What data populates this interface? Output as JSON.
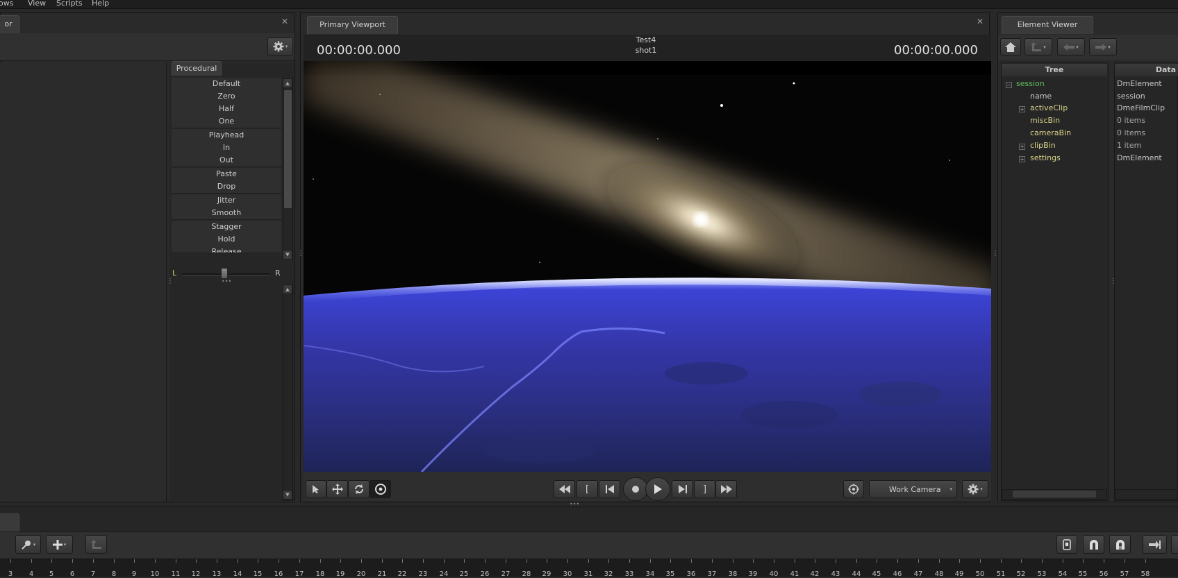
{
  "menu": [
    "ows",
    "View",
    "Scripts",
    "Help"
  ],
  "left_panel": {
    "tab_label": "or",
    "procedural_tab": "Procedural",
    "procedural_items": [
      "Default",
      "Zero",
      "Half",
      "One",
      "Playhead",
      "In",
      "Out",
      "Paste",
      "Drop",
      "Jitter",
      "Smooth",
      "Stagger",
      "Hold",
      "Release"
    ],
    "balance_left": "L",
    "balance_right": "R"
  },
  "viewport": {
    "tab_label": "Primary Viewport",
    "timecode_left": "00:00:00.000",
    "timecode_right": "00:00:00.000",
    "clip_name": "Test4",
    "shot_name": "shot1",
    "camera_label": "Work Camera"
  },
  "element_viewer": {
    "tab_label": "Element Viewer",
    "tree_header": "Tree",
    "data_header": "Data",
    "rows": [
      {
        "label": "session",
        "data": "DmElement"
      },
      {
        "label": "name",
        "data": "session"
      },
      {
        "label": "activeClip",
        "data": "DmeFilmClip"
      },
      {
        "label": "miscBin",
        "data": "0 items"
      },
      {
        "label": "cameraBin",
        "data": "0 items"
      },
      {
        "label": "clipBin",
        "data": "1 item"
      },
      {
        "label": "settings",
        "data": "DmElement"
      }
    ]
  },
  "ruler_labels": [
    "3",
    "4",
    "5",
    "6",
    "7",
    "8",
    "9",
    "10",
    "11",
    "12",
    "13",
    "14",
    "15",
    "16",
    "17",
    "18",
    "19",
    "20",
    "21",
    "22",
    "23",
    "24",
    "25",
    "26",
    "27",
    "28",
    "29",
    "30",
    "31",
    "32",
    "33",
    "34",
    "35",
    "36",
    "37",
    "38",
    "39",
    "40",
    "41",
    "42",
    "43",
    "44",
    "45",
    "46",
    "47",
    "48",
    "49",
    "50",
    "51",
    "52",
    "53",
    "54",
    "55",
    "56",
    "57",
    "58"
  ],
  "colors": {
    "background": "#282828",
    "tree_session": "#5ec25e",
    "tree_label": "#d8d28a",
    "text": "#c8c8c8"
  }
}
